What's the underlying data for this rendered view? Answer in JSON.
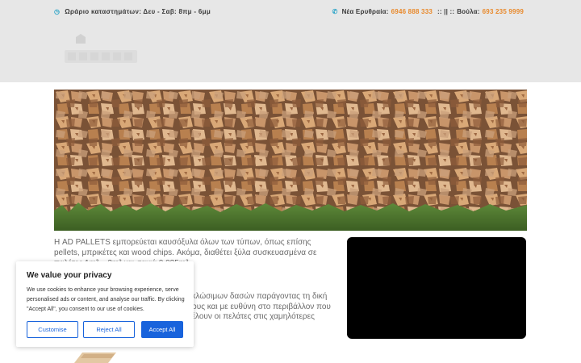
{
  "topbar": {
    "hours_text": "Ωράριο καταστημάτων: Δευ - Σαβ: 8πμ - 6μμ",
    "phone1_label": "Νέα Ερυθραία:",
    "phone1": "6946 888 333",
    "separator": ":: || ::",
    "phone2_label": "Βούλα:",
    "phone2": "693 235 9999"
  },
  "content": {
    "intro": "Η AD PALLETS εμπορεύεται καυσόξυλα όλων των τύπων, όπως επίσης pellets, μπρικέτες και wood chips. Ακόμα, διαθέτει ξύλα συσκευασμένα σε παλέτες 1m³ – 2m³ και σακιά 0,035m³.",
    "line2": "η.",
    "para": "υκλώσιμων δασών παράγοντας τη δική σους και με ευθύνη στο περιβάλλον που θέλουν οι πελάτες στις χαμηλότερες"
  },
  "cookie": {
    "title": "We value your privacy",
    "text": "We use cookies to enhance your browsing experience, serve personalised ads or content, and analyse our traffic. By clicking \"Accept All\", you consent to our use of cookies.",
    "customise": "Customise",
    "reject": "Reject All",
    "accept": "Accept All"
  },
  "colors": {
    "accent_orange": "#e8892b",
    "icon_blue": "#29a3c7",
    "cookie_blue": "#1863dc"
  }
}
